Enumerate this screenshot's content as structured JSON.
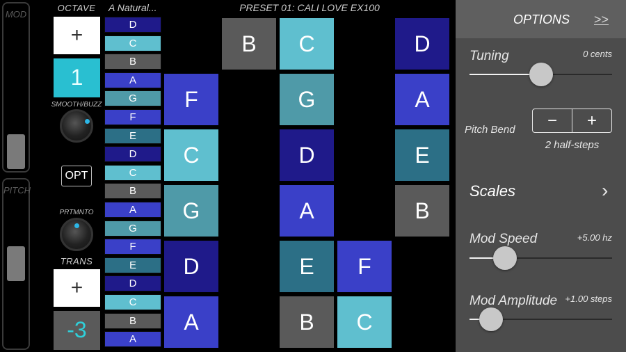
{
  "left_strips": {
    "mod_label": "MOD",
    "pitch_label": "PITCH"
  },
  "controls": {
    "octave_label": "OCTAVE",
    "octave_plus": "+",
    "octave_value": "1",
    "smooth_label": "SMOOTH/BUZZ",
    "opt_label": "OPT",
    "portamento_label": "PRTMNTO",
    "trans_label": "TRANS",
    "trans_plus": "+",
    "trans_value": "-3"
  },
  "header": {
    "scale_name": "A Natural...",
    "preset_title": "PRESET 01: CALI LOVE EX100"
  },
  "scale_column": {
    "cells": [
      {
        "note": "D",
        "color": "#1f1a8a"
      },
      {
        "note": "C",
        "color": "#5fbfcf"
      },
      {
        "note": "B",
        "color": "#5a5a5a"
      },
      {
        "note": "A",
        "color": "#3a40c8"
      },
      {
        "note": "G",
        "color": "#4f9aa8"
      },
      {
        "note": "F",
        "color": "#3a40c8"
      },
      {
        "note": "E",
        "color": "#2c6f86"
      },
      {
        "note": "D",
        "color": "#1f1a8a"
      },
      {
        "note": "C",
        "color": "#5fbfcf"
      },
      {
        "note": "B",
        "color": "#5a5a5a"
      },
      {
        "note": "A",
        "color": "#3a40c8"
      },
      {
        "note": "G",
        "color": "#4f9aa8"
      },
      {
        "note": "F",
        "color": "#3a40c8"
      },
      {
        "note": "E",
        "color": "#2c6f86"
      },
      {
        "note": "D",
        "color": "#1f1a8a"
      },
      {
        "note": "C",
        "color": "#5fbfcf"
      },
      {
        "note": "B",
        "color": "#5a5a5a"
      },
      {
        "note": "A",
        "color": "#3a40c8"
      }
    ]
  },
  "grid": {
    "rows": [
      [
        {
          "note": "",
          "color": "#000000"
        },
        {
          "note": "B",
          "color": "#5a5a5a"
        },
        {
          "note": "C",
          "color": "#5fbfcf"
        },
        {
          "note": "",
          "color": "#000000"
        },
        {
          "note": "D",
          "color": "#1f1a8a"
        }
      ],
      [
        {
          "note": "F",
          "color": "#3a40c8"
        },
        {
          "note": "",
          "color": "#000000"
        },
        {
          "note": "G",
          "color": "#4f9aa8"
        },
        {
          "note": "",
          "color": "#000000"
        },
        {
          "note": "A",
          "color": "#3a40c8"
        }
      ],
      [
        {
          "note": "C",
          "color": "#5fbfcf"
        },
        {
          "note": "",
          "color": "#000000"
        },
        {
          "note": "D",
          "color": "#1f1a8a"
        },
        {
          "note": "",
          "color": "#000000"
        },
        {
          "note": "E",
          "color": "#2c6f86"
        }
      ],
      [
        {
          "note": "G",
          "color": "#4f9aa8"
        },
        {
          "note": "",
          "color": "#000000"
        },
        {
          "note": "A",
          "color": "#3a40c8"
        },
        {
          "note": "",
          "color": "#000000"
        },
        {
          "note": "B",
          "color": "#5a5a5a"
        }
      ],
      [
        {
          "note": "D",
          "color": "#1f1a8a"
        },
        {
          "note": "",
          "color": "#000000"
        },
        {
          "note": "E",
          "color": "#2c6f86"
        },
        {
          "note": "F",
          "color": "#3a40c8"
        },
        {
          "note": "",
          "color": "#000000"
        }
      ],
      [
        {
          "note": "A",
          "color": "#3a40c8"
        },
        {
          "note": "",
          "color": "#000000"
        },
        {
          "note": "B",
          "color": "#5a5a5a"
        },
        {
          "note": "C",
          "color": "#5fbfcf"
        },
        {
          "note": "",
          "color": "#000000"
        }
      ]
    ]
  },
  "options": {
    "title": "OPTIONS",
    "collapse": ">>",
    "tuning_label": "Tuning",
    "tuning_value": "0 cents",
    "tuning_level": 0.5,
    "pitch_bend_label": "Pitch Bend",
    "pitch_bend_minus": "−",
    "pitch_bend_plus": "+",
    "pitch_bend_value": "2 half-steps",
    "scales_label": "Scales",
    "scales_chevron": "›",
    "mod_speed_label": "Mod Speed",
    "mod_speed_value": "+5.00 hz",
    "mod_speed_level": 0.25,
    "mod_amp_label": "Mod Amplitude",
    "mod_amp_value": "+1.00 steps",
    "mod_amp_level": 0.15
  },
  "colors": {
    "accent": "#29bfd1",
    "panel": "#4c4c4c",
    "panel_header": "#5f5f5f"
  }
}
